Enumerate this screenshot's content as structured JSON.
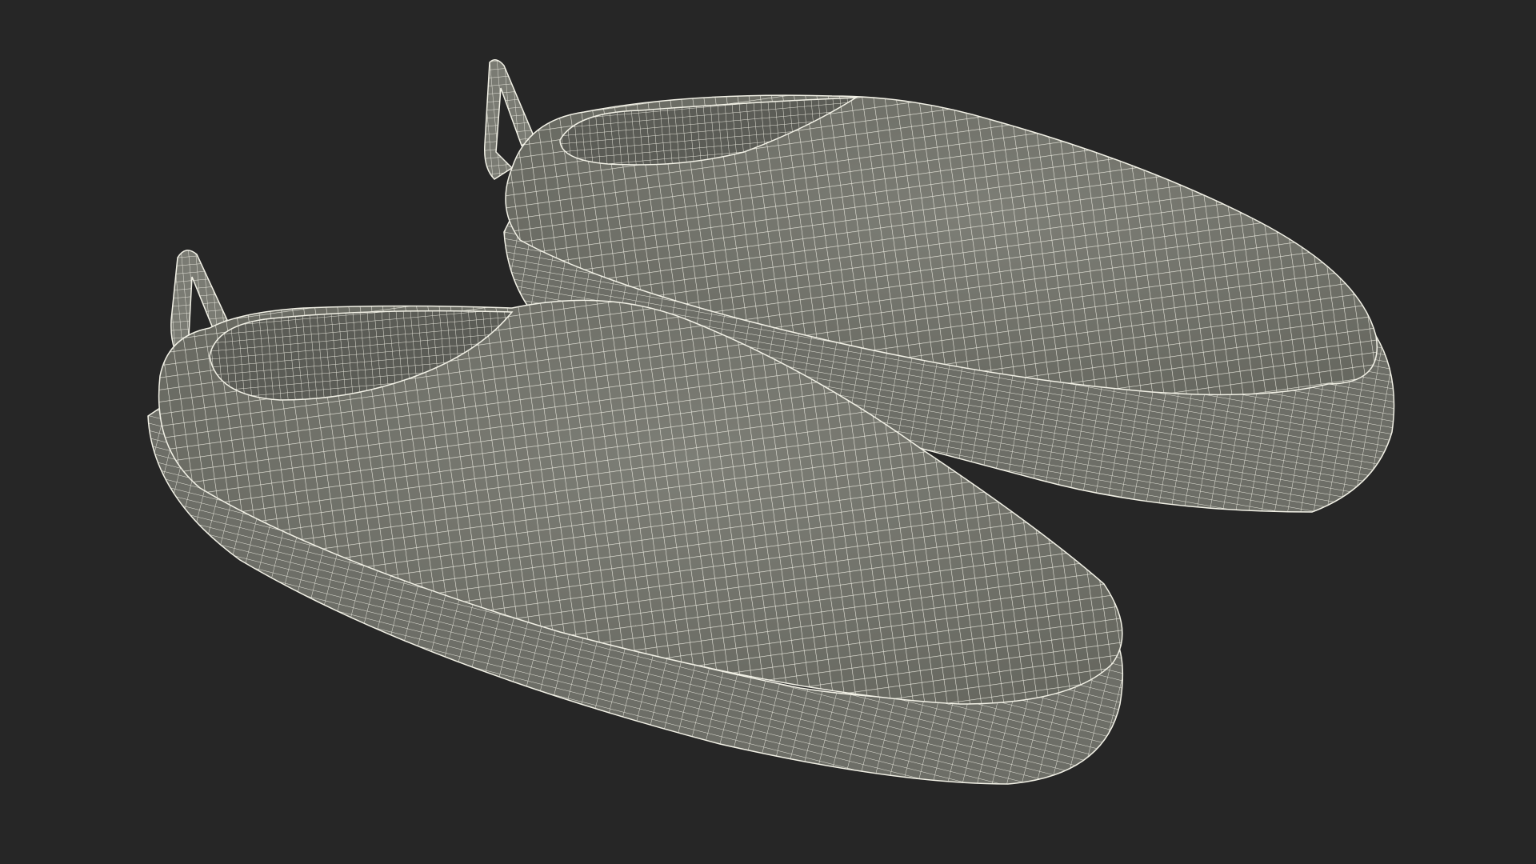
{
  "scene": {
    "subject": "pair-of-slippers-wireframe",
    "render_mode": "wireframe",
    "objects": [
      {
        "name": "slipper-back",
        "role": "rear"
      },
      {
        "name": "slipper-front",
        "role": "front"
      }
    ]
  },
  "colors": {
    "background": "#262626",
    "shell_fill": "#76776f",
    "shell_shadow": "#63645d",
    "inner_fill": "#5b5c56",
    "sole_fill": "#6d6e67",
    "wire": "#f2f1e6"
  }
}
